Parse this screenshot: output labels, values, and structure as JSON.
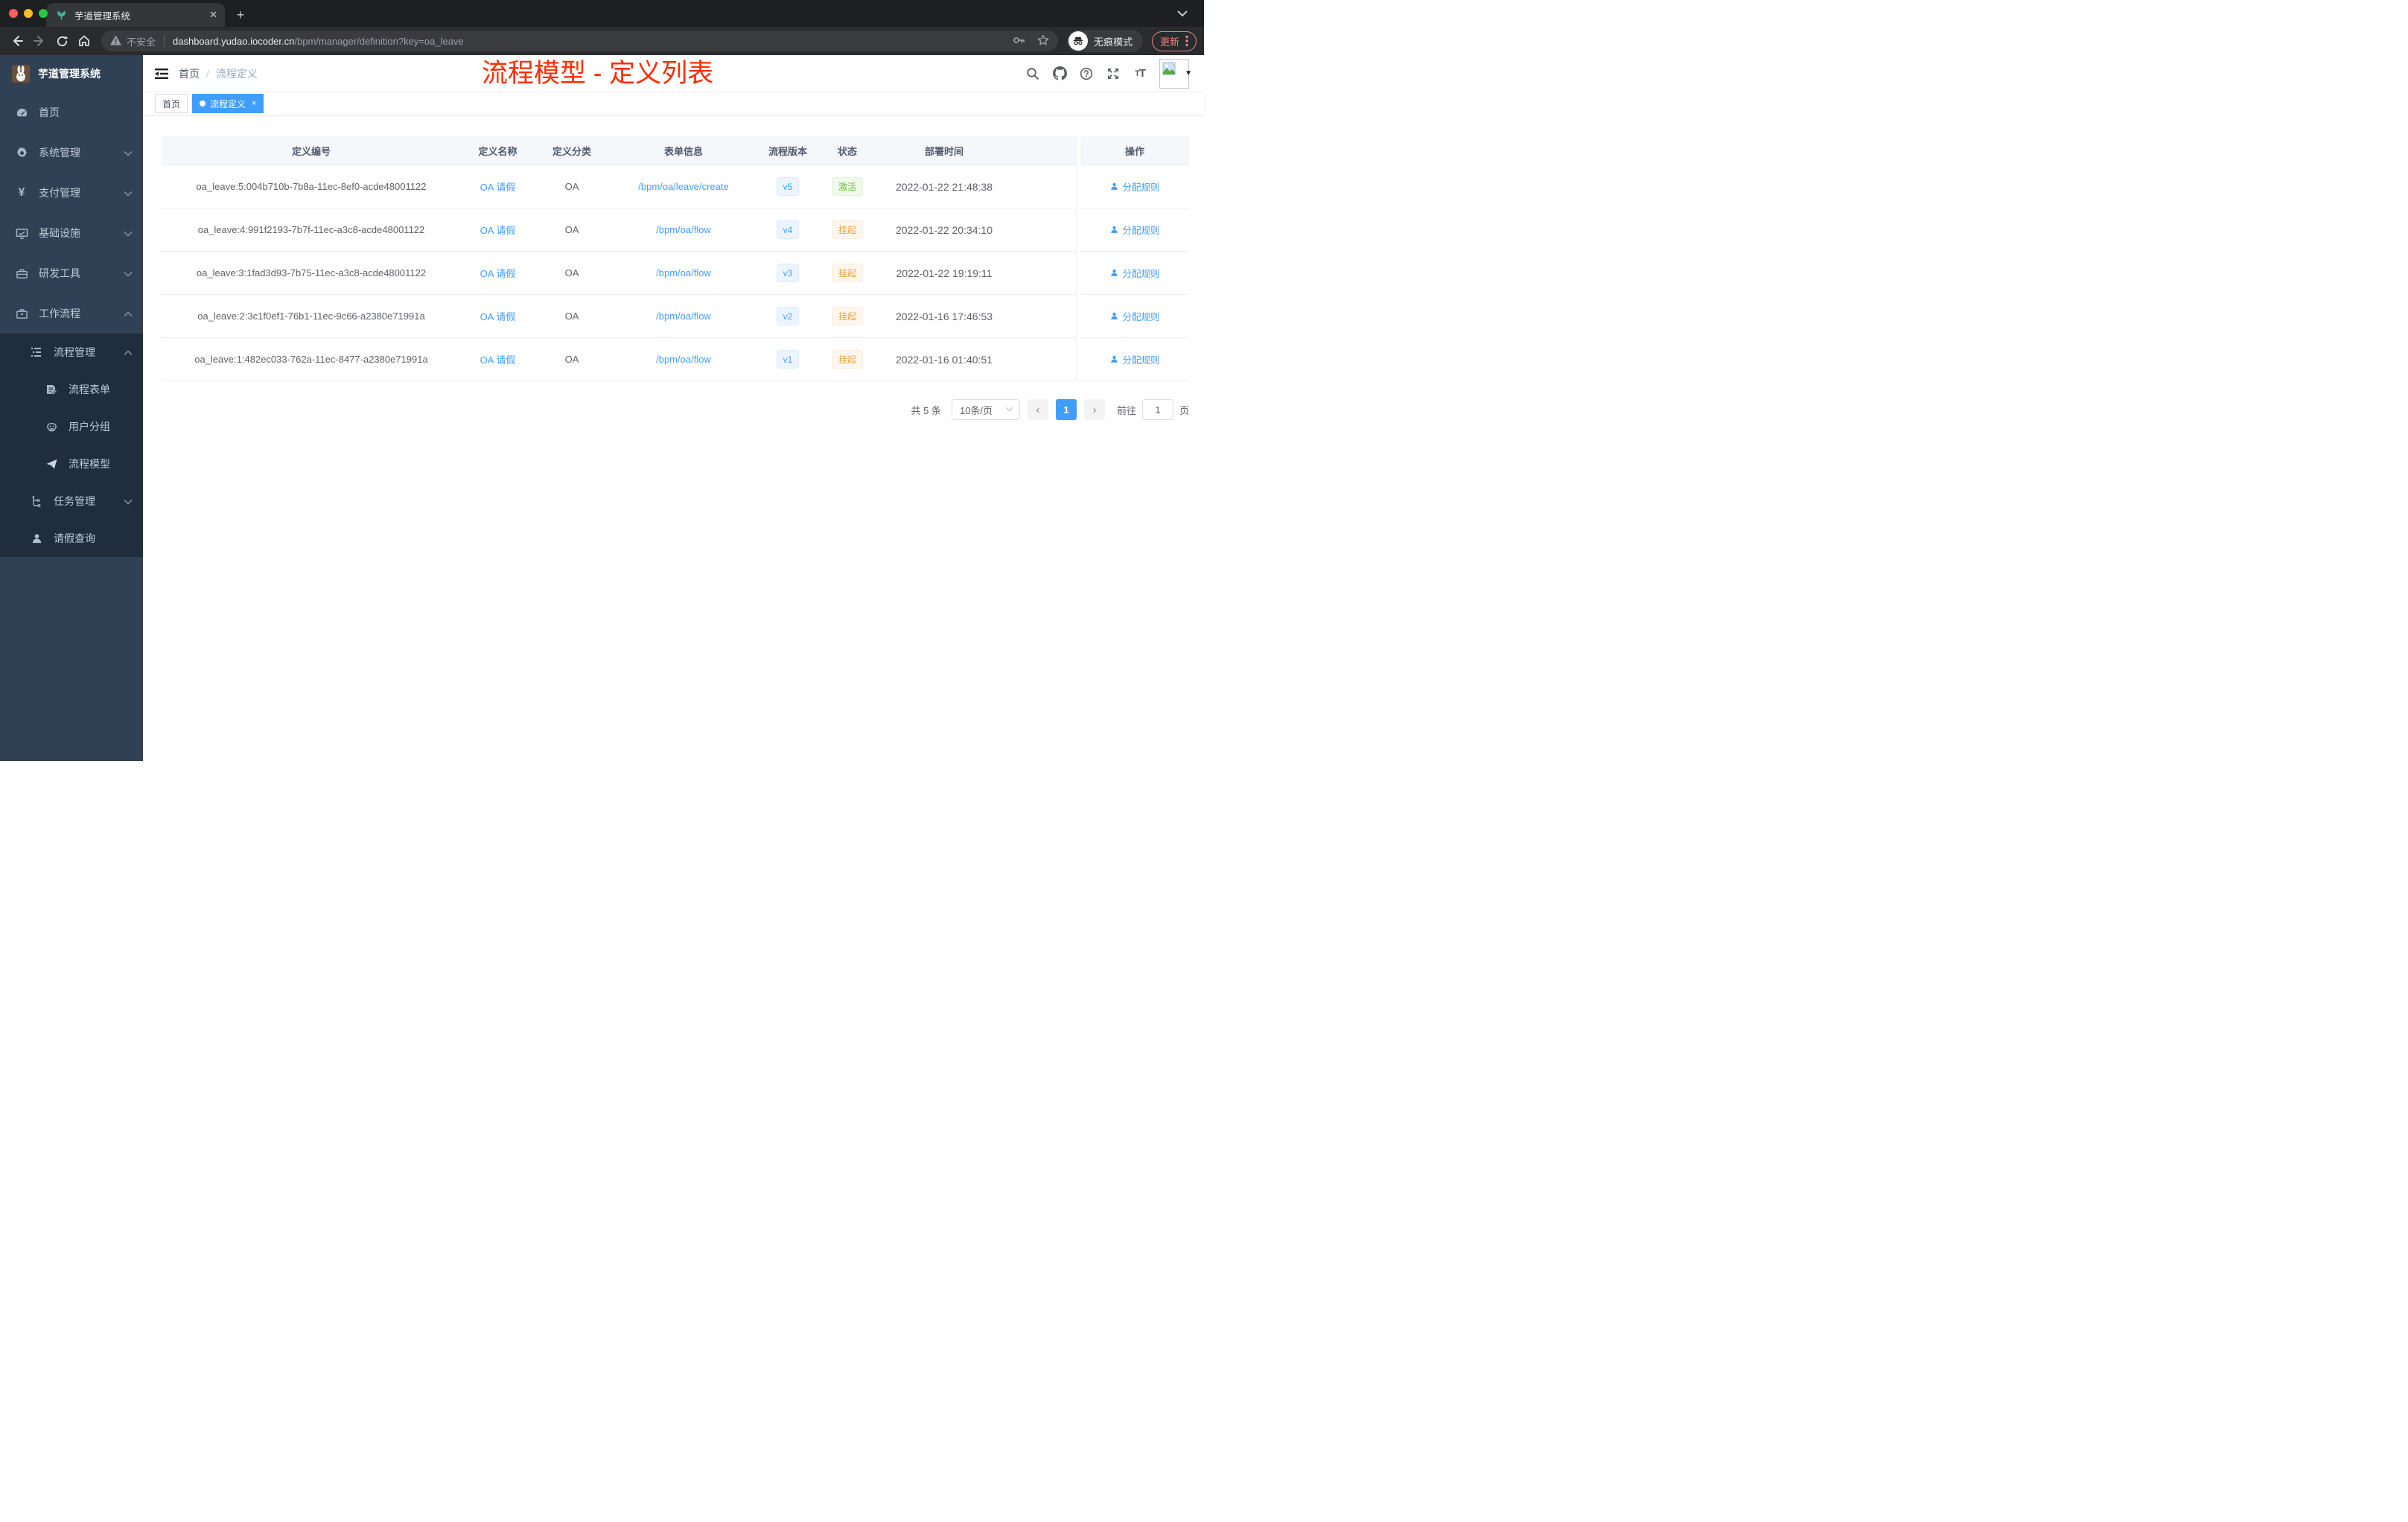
{
  "browser": {
    "tab_title": "芋道管理系统",
    "new_tab_label": "+",
    "close_tab_label": "✕",
    "security_label": "不安全",
    "url_host": "dashboard.yudao.iocoder.cn",
    "url_path": "/bpm/manager/definition?key=oa_leave",
    "incognito_label": "无痕模式",
    "update_label": "更新"
  },
  "sidebar": {
    "logo_title": "芋道管理系统",
    "items": [
      {
        "label": "首页",
        "icon": "dashboard-icon",
        "level": 1
      },
      {
        "label": "系统管理",
        "icon": "gear-icon",
        "level": 1,
        "expanded": false
      },
      {
        "label": "支付管理",
        "icon": "yen-icon",
        "level": 1,
        "expanded": false
      },
      {
        "label": "基础设施",
        "icon": "monitor-icon",
        "level": 1,
        "expanded": false
      },
      {
        "label": "研发工具",
        "icon": "toolbox-icon",
        "level": 1,
        "expanded": false
      },
      {
        "label": "工作流程",
        "icon": "briefcase-icon",
        "level": 1,
        "expanded": true
      },
      {
        "label": "流程管理",
        "icon": "tree-list-icon",
        "level": 2,
        "expanded": true
      },
      {
        "label": "流程表单",
        "icon": "form-icon",
        "level": 3
      },
      {
        "label": "用户分组",
        "icon": "robot-icon",
        "level": 3
      },
      {
        "label": "流程模型",
        "icon": "paper-plane-icon",
        "level": 3
      },
      {
        "label": "任务管理",
        "icon": "tree-icon",
        "level": 2,
        "expanded": false
      },
      {
        "label": "请假查询",
        "icon": "user-icon",
        "level": 2
      }
    ]
  },
  "header": {
    "breadcrumb_home": "首页",
    "breadcrumb_separator": "/",
    "breadcrumb_current": "流程定义",
    "page_title": "流程模型 - 定义列表",
    "title_color": "#ff2d00"
  },
  "tags": {
    "home": "首页",
    "active": "流程定义",
    "active_close": "×"
  },
  "table": {
    "columns": [
      "定义编号",
      "定义名称",
      "定义分类",
      "表单信息",
      "流程版本",
      "状态",
      "部署时间",
      "操作"
    ],
    "rows": [
      {
        "id": "oa_leave:5:004b710b-7b8a-11ec-8ef0-acde48001122",
        "name": "OA 请假",
        "category": "OA",
        "form": "/bpm/oa/leave/create",
        "version": "v5",
        "status": "激活",
        "status_type": "success",
        "time": "2022-01-22 21:48:38",
        "action": "分配规则"
      },
      {
        "id": "oa_leave:4:991f2193-7b7f-11ec-a3c8-acde48001122",
        "name": "OA 请假",
        "category": "OA",
        "form": "/bpm/oa/flow",
        "version": "v4",
        "status": "挂起",
        "status_type": "warning",
        "time": "2022-01-22 20:34:10",
        "action": "分配规则"
      },
      {
        "id": "oa_leave:3:1fad3d93-7b75-11ec-a3c8-acde48001122",
        "name": "OA 请假",
        "category": "OA",
        "form": "/bpm/oa/flow",
        "version": "v3",
        "status": "挂起",
        "status_type": "warning",
        "time": "2022-01-22 19:19:11",
        "action": "分配规则"
      },
      {
        "id": "oa_leave:2:3c1f0ef1-76b1-11ec-9c66-a2380e71991a",
        "name": "OA 请假",
        "category": "OA",
        "form": "/bpm/oa/flow",
        "version": "v2",
        "status": "挂起",
        "status_type": "warning",
        "time": "2022-01-16 17:46:53",
        "action": "分配规则"
      },
      {
        "id": "oa_leave:1:482ec033-762a-11ec-8477-a2380e71991a",
        "name": "OA 请假",
        "category": "OA",
        "form": "/bpm/oa/flow",
        "version": "v1",
        "status": "挂起",
        "status_type": "warning",
        "time": "2022-01-16 01:40:51",
        "action": "分配规则"
      }
    ]
  },
  "pagination": {
    "total_label": "共 5 条",
    "page_size_label": "10条/页",
    "prev_label": "‹",
    "current_page": "1",
    "next_label": "›",
    "goto_label": "前往",
    "goto_value": "1",
    "page_suffix": "页"
  },
  "colors": {
    "accent_blue": "#409eff",
    "title_red": "#ff2d00",
    "sidebar_bg": "#304156",
    "submenu_bg": "#1f2d3d",
    "tag_success_text": "#67c23a",
    "tag_warning_text": "#e6a23c",
    "table_header_bg": "#f5f7fa"
  }
}
